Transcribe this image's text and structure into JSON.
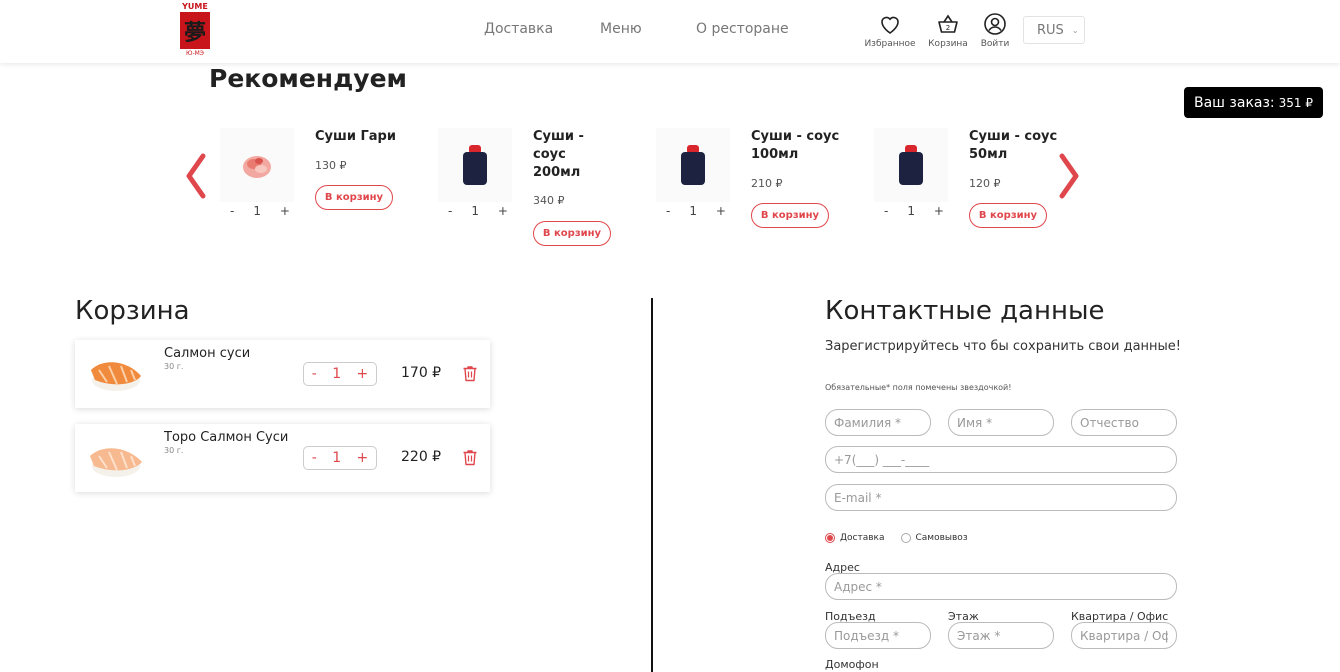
{
  "header": {
    "logo": {
      "top": "YUME",
      "bottom": "Ю-МЭ"
    },
    "nav": [
      "Доставка",
      "Меню",
      "О ресторане"
    ],
    "favorites_label": "Избранное",
    "cart_label": "Корзина",
    "cart_count": "2",
    "login_label": "Войти",
    "language": "RUS"
  },
  "order_badge": {
    "label": "Ваш заказ:",
    "amount": "351 ₽"
  },
  "recommended": {
    "title": "Рекомендуем",
    "products": [
      {
        "name": "Суши Гари",
        "price": "130 ₽",
        "qty": "1",
        "button": "В корзину",
        "image": "pickled-ginger"
      },
      {
        "name": "Суши - соус 200мл",
        "price": "340 ₽",
        "qty": "1",
        "button": "В корзину",
        "image": "sauce-bottle"
      },
      {
        "name": "Суши - соус 100мл",
        "price": "210 ₽",
        "qty": "1",
        "button": "В корзину",
        "image": "sauce-bottle"
      },
      {
        "name": "Суши - соус 50мл",
        "price": "120 ₽",
        "qty": "1",
        "button": "В корзину",
        "image": "sauce-bottle"
      }
    ],
    "minus": "-",
    "plus": "+"
  },
  "cart": {
    "title": "Корзина",
    "items": [
      {
        "name": "Салмон суси",
        "weight": "30 г.",
        "qty": "1",
        "price": "170 ₽"
      },
      {
        "name": "Торо Салмон Суси",
        "weight": "30 г.",
        "qty": "1",
        "price": "220 ₽"
      }
    ],
    "minus": "-",
    "plus": "+"
  },
  "contact": {
    "title": "Контактные данные",
    "subtitle": "Зарегистрируйтесь что бы сохранить свои данные!",
    "required_note": "Обязательные* поля помечены звездочкой!",
    "last_name_placeholder": "Фамилия *",
    "first_name_placeholder": "Имя *",
    "middle_name_placeholder": "Отчество",
    "phone_placeholder": "+7(___) ___-____",
    "email_placeholder": "E-mail *",
    "delivery_option": "Доставка",
    "pickup_option": "Самовывоз",
    "address_label": "Адрес",
    "address_placeholder": "Адрес *",
    "entrance_label": "Подъезд",
    "entrance_placeholder": "Подъезд *",
    "floor_label": "Этаж",
    "floor_placeholder": "Этаж *",
    "apartment_label": "Квартира / Офис",
    "apartment_placeholder": "Квартира / Офис",
    "intercom_label": "Домофон"
  },
  "colors": {
    "accent": "#e0474c",
    "brand_red": "#c8151b",
    "badge_bg": "#000000"
  }
}
